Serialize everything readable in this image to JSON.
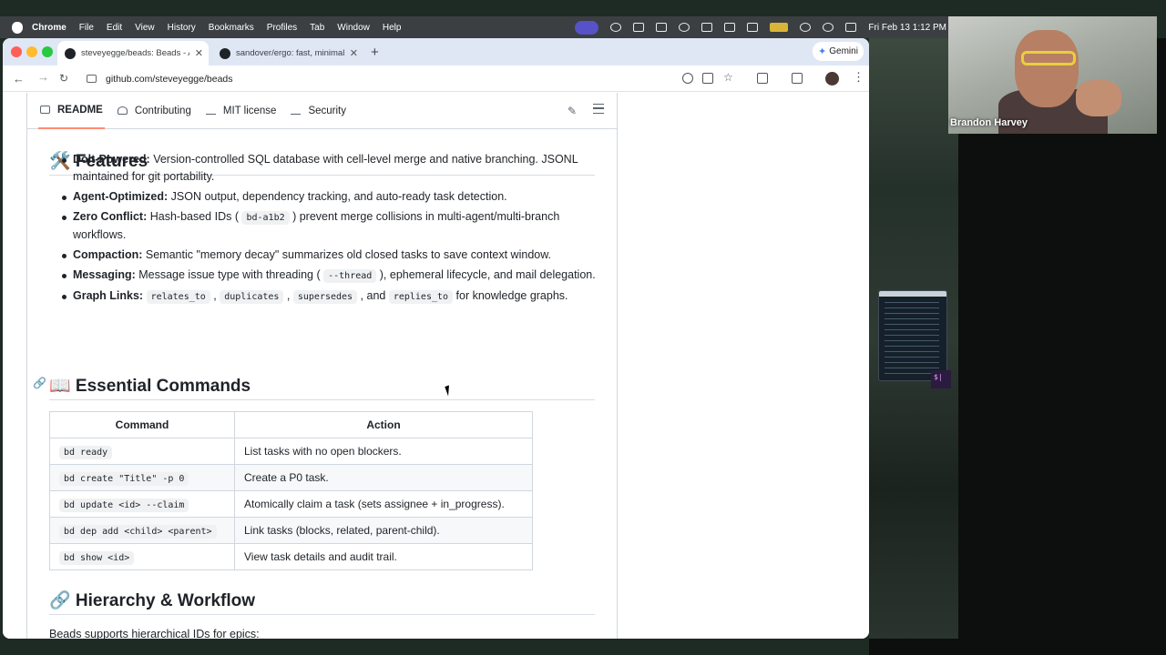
{
  "menubar": {
    "app": "Chrome",
    "items": [
      "File",
      "Edit",
      "View",
      "History",
      "Bookmarks",
      "Profiles",
      "Tab",
      "Window",
      "Help"
    ],
    "clock": "Fri Feb 13  1:12 PM"
  },
  "browser": {
    "tabs": [
      {
        "title": "steveyegge/beads: Beads - A",
        "close": "✕"
      },
      {
        "title": "sandover/ergo: fast, minimal",
        "close": "✕"
      }
    ],
    "new_tab": "+",
    "gemini": "Gemini",
    "url": "github.com/steveyegge/beads"
  },
  "repo_tabs": [
    "README",
    "Contributing",
    "MIT license",
    "Security"
  ],
  "features": {
    "title": "🛠️ Features",
    "items": [
      {
        "label": "Dolt-Powered:",
        "text": " Version-controlled SQL database with cell-level merge and native branching. JSONL maintained for git portability."
      },
      {
        "label": "Agent-Optimized:",
        "text": " JSON output, dependency tracking, and auto-ready task detection."
      },
      {
        "label": "Zero Conflict:",
        "pre": " Hash-based IDs ( ",
        "code": "bd-a1b2",
        "post": " ) prevent merge collisions in multi-agent/multi-branch workflows."
      },
      {
        "label": "Compaction:",
        "text": " Semantic \"memory decay\" summarizes old closed tasks to save context window."
      },
      {
        "label": "Messaging:",
        "pre": " Message issue type with threading ( ",
        "code": "--thread",
        "post": " ), ephemeral lifecycle, and mail delegation."
      },
      {
        "label": "Graph Links:",
        "code1": "relates_to",
        "code2": "duplicates",
        "code3": "supersedes",
        "sep1": " , ",
        "sep2": " , ",
        "sep3": " , and ",
        "code4": "replies_to",
        "post": " for knowledge graphs."
      }
    ]
  },
  "commands": {
    "title": "📖 Essential Commands",
    "headers": [
      "Command",
      "Action"
    ],
    "rows": [
      {
        "cmd": "bd ready",
        "action": "List tasks with no open blockers."
      },
      {
        "cmd": "bd create \"Title\" -p 0",
        "action": "Create a P0 task."
      },
      {
        "cmd": "bd update <id> --claim",
        "action": "Atomically claim a task (sets assignee + in_progress)."
      },
      {
        "cmd": "bd dep add <child> <parent>",
        "action": "Link tasks (blocks, related, parent-child)."
      },
      {
        "cmd": "bd show <id>",
        "action": "View task details and audit trail."
      }
    ]
  },
  "hierarchy": {
    "title": "🔗 Hierarchy & Workflow",
    "text": "Beads supports hierarchical IDs for epics:"
  },
  "webcam": {
    "name": "Brandon Harvey"
  },
  "desktop": {
    "prompt": "$|"
  }
}
